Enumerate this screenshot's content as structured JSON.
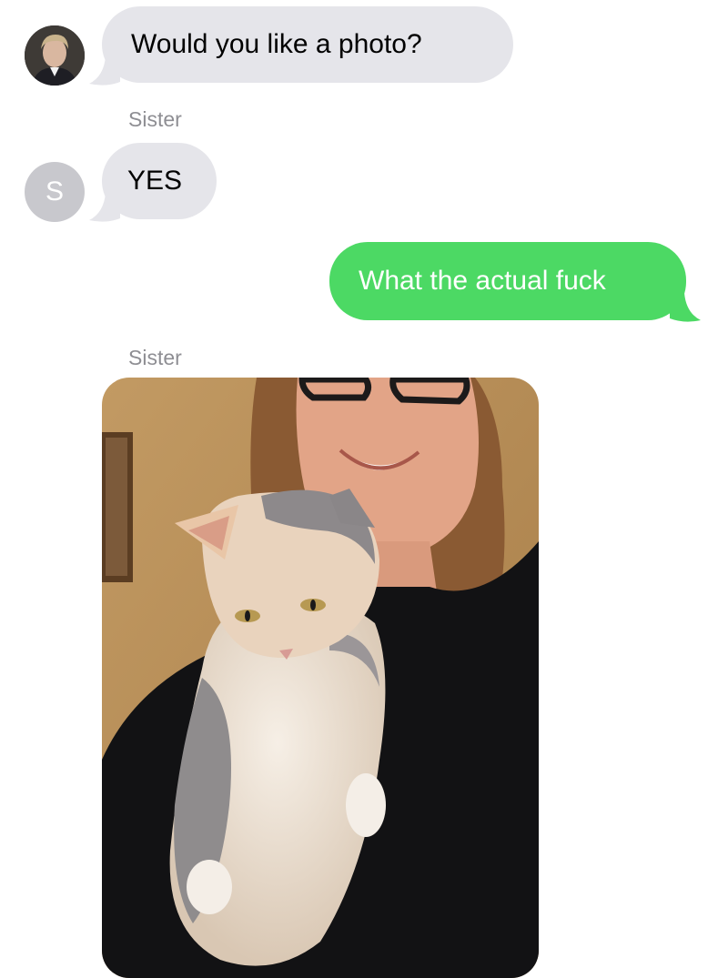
{
  "conversation": {
    "messages": [
      {
        "direction": "incoming",
        "text": "Would you like a photo?"
      },
      {
        "direction": "incoming",
        "sender": "Sister",
        "avatar_initial": "S",
        "text": "YES"
      },
      {
        "direction": "outgoing",
        "text": "What the actual fuck"
      },
      {
        "direction": "incoming",
        "sender": "Sister",
        "attachment": "photo of a smiling woman with glasses holding a calico cat"
      }
    ]
  },
  "colors": {
    "incoming_bubble": "#e5e5ea",
    "outgoing_bubble": "#4cd964",
    "sender_label": "#8e8e93",
    "avatar_placeholder": "#c8c8cd"
  }
}
